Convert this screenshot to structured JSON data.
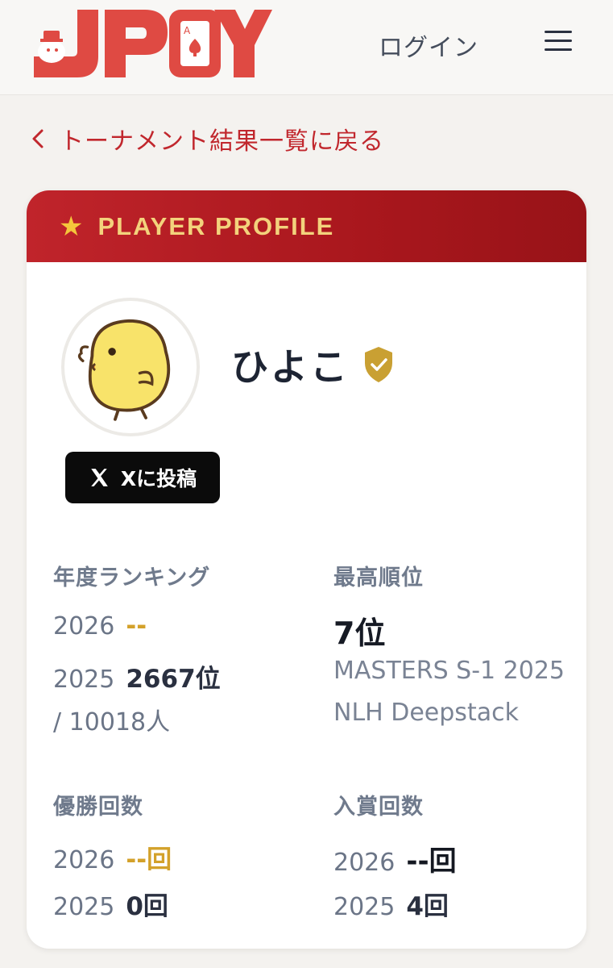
{
  "header": {
    "logo_text": "JPOY",
    "login_label": "ログイン",
    "menu_icon": "hamburger-icon"
  },
  "nav": {
    "back_label": "トーナメント結果一覧に戻る",
    "back_icon": "chevron-left-icon"
  },
  "profile": {
    "section_title": "PLAYER PROFILE",
    "star_icon": "★",
    "player_name": "ひよこ",
    "verified_icon": "verified-shield-icon",
    "x_post_label": "Xに投稿",
    "x_icon": "x-logo-icon"
  },
  "stats": {
    "annual_ranking": {
      "label": "年度ランキング",
      "y2026": {
        "year": "2026",
        "value": "--"
      },
      "y2025": {
        "year": "2025",
        "value": "2667位",
        "total": "/ 10018人"
      }
    },
    "best_rank": {
      "label": "最高順位",
      "value": "7位",
      "event_line1": "MASTERS S-1 2025",
      "event_line2": "NLH Deepstack"
    },
    "wins": {
      "label": "優勝回数",
      "y2026": {
        "year": "2026",
        "value": "--回"
      },
      "y2025": {
        "year": "2025",
        "value": "0回"
      }
    },
    "placements": {
      "label": "入賞回数",
      "y2026": {
        "year": "2026",
        "value": "--回"
      },
      "y2025": {
        "year": "2025",
        "value": "4回"
      }
    }
  },
  "colors": {
    "brand_red": "#c1272d",
    "gold": "#d3a12a",
    "header_title": "#f3d27c"
  }
}
